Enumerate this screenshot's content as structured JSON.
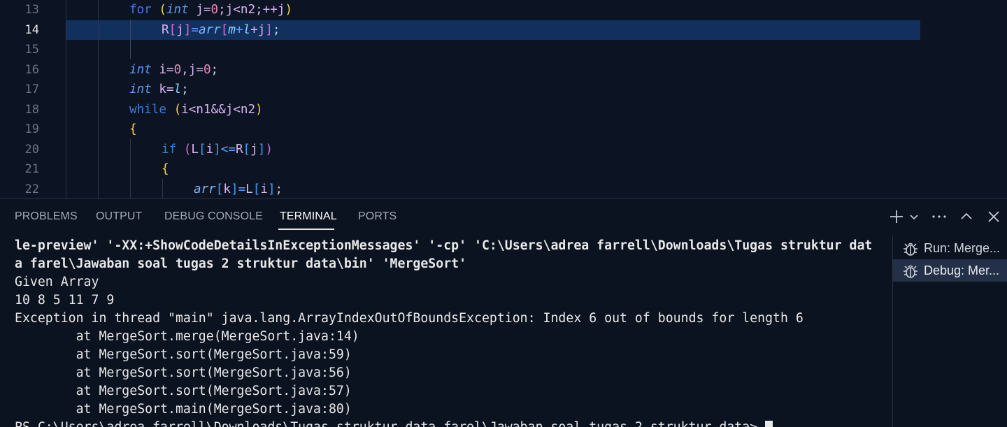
{
  "editor": {
    "line_numbers": [
      "13",
      "14",
      "15",
      "16",
      "17",
      "18",
      "19",
      "20",
      "21",
      "22"
    ],
    "active_line": "14",
    "code": {
      "l13": {
        "kw": "for",
        "p": "(",
        "t": "int",
        "rest": "j=",
        "n": "0",
        "a": ";j<n2;++j",
        "pc": ")"
      },
      "l14": {
        "a": "R",
        "b": "[",
        "c": "j",
        "d": "]=",
        "e": "arr",
        "f": "[",
        "g": "m",
        "h": "+",
        "i": "l",
        "j": "+j",
        "k": "];"
      },
      "l16": {
        "t": "int",
        "a": " i=",
        "n1": "0",
        "b": ",j=",
        "n2": "0",
        "c": ";"
      },
      "l17": {
        "t": "int",
        "a": " k=",
        "p": "l",
        "c": ";"
      },
      "l18": {
        "kw": "while",
        "p": "(",
        "a": "i<n1&&j<n2",
        "pc": ")"
      },
      "l19": {
        "b": "{"
      },
      "l20": {
        "kw": "if",
        "p": "(",
        "a": "L",
        "b": "[",
        "c": "i",
        "d": "]<=R",
        "e": "[",
        "f": "j",
        "g": "]",
        "pc": ")"
      },
      "l21": {
        "b": "{"
      },
      "l22": {
        "a": "arr",
        "b": "[",
        "c": "k",
        "d": "]=L",
        "e": "[",
        "f": "i",
        "g": "];"
      }
    }
  },
  "panel": {
    "tabs": [
      "PROBLEMS",
      "OUTPUT",
      "DEBUG CONSOLE",
      "TERMINAL",
      "PORTS"
    ],
    "active_tab": "TERMINAL",
    "actions": {
      "add": "+",
      "chevron": "⌄",
      "more": "···",
      "maximize": "^",
      "close": "✕"
    }
  },
  "terminal": {
    "lines": [
      "le-preview' '-XX:+ShowCodeDetailsInExceptionMessages' '-cp' 'C:\\Users\\adrea farrell\\Downloads\\Tugas struktur dat",
      "a farel\\Jawaban soal tugas 2 struktur data\\bin' 'MergeSort'",
      "Given Array",
      "10 8 5 11 7 9",
      "Exception in thread \"main\" java.lang.ArrayIndexOutOfBoundsException: Index 6 out of bounds for length 6",
      "        at MergeSort.merge(MergeSort.java:14)",
      "        at MergeSort.sort(MergeSort.java:59)",
      "        at MergeSort.sort(MergeSort.java:56)",
      "        at MergeSort.sort(MergeSort.java:57)",
      "        at MergeSort.main(MergeSort.java:80)",
      "PS C:\\Users\\adrea farrell\\Downloads\\Tugas struktur data farel\\Jawaban soal tugas 2 struktur data> "
    ],
    "sessions": [
      {
        "label": "Run: Merge...",
        "icon": "debug-bug-icon"
      },
      {
        "label": "Debug: Mer...",
        "icon": "debug-bug-icon"
      }
    ],
    "active_session": 1
  }
}
